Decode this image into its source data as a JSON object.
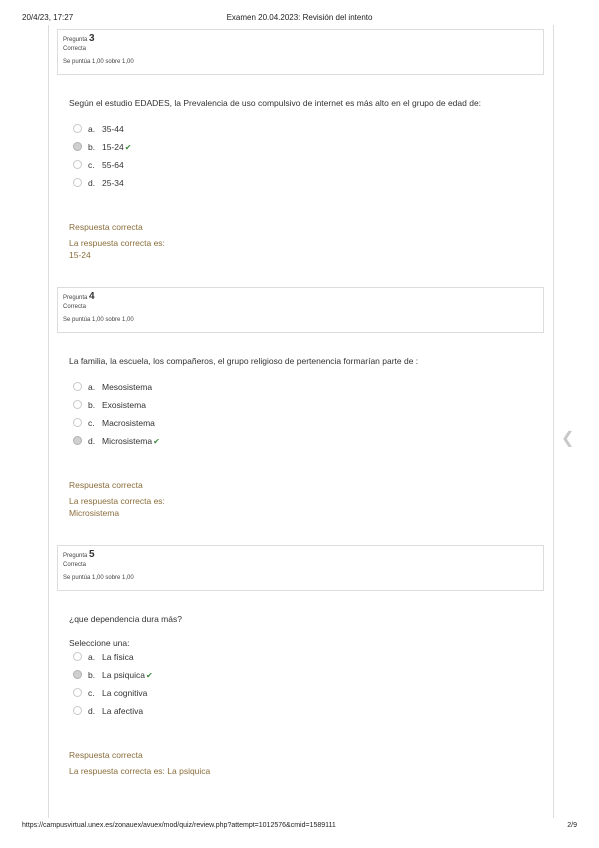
{
  "print_header": {
    "date": "20/4/23, 17:27",
    "title": "Examen 20.04.2023: Revisión del intento"
  },
  "print_footer": {
    "url": "https://campusvirtual.unex.es/zonauex/avuex/mod/quiz/review.php?attempt=1012576&cmid=1589111",
    "pages": "2/9"
  },
  "questions": [
    {
      "label": "Pregunta",
      "number": "3",
      "state": "Correcta",
      "grade": "Se puntúa 1,00 sobre 1,00",
      "text": "Según el estudio EDADES,  la Prevalencia de uso compulsivo de internet es más alto en el grupo de edad de:",
      "options": [
        {
          "letter": "a.",
          "text": "35-44"
        },
        {
          "letter": "b.",
          "text": "15-24"
        },
        {
          "letter": "c.",
          "text": "55-64"
        },
        {
          "letter": "d.",
          "text": "25-34"
        }
      ],
      "feedback": "Respuesta correcta",
      "answer_label": "La respuesta correcta es:",
      "answer": "15-24"
    },
    {
      "label": "Pregunta",
      "number": "4",
      "state": "Correcta",
      "grade": "Se puntúa 1,00 sobre 1,00",
      "text": "La familia, la escuela, los compañeros, el grupo religioso de pertenencia formarían parte de :",
      "options": [
        {
          "letter": "a.",
          "text": "Mesosistema"
        },
        {
          "letter": "b.",
          "text": "Exosistema"
        },
        {
          "letter": "c.",
          "text": "Macrosistema"
        },
        {
          "letter": "d.",
          "text": "Microsistema"
        }
      ],
      "feedback": "Respuesta correcta",
      "answer_label": "La respuesta correcta es:",
      "answer": "Microsistema"
    },
    {
      "label": "Pregunta",
      "number": "5",
      "state": "Correcta",
      "grade": "Se puntúa 1,00 sobre 1,00",
      "text": "¿que dependencia dura más?",
      "prompt": "Seleccione una:",
      "options": [
        {
          "letter": "a.",
          "text": "La física"
        },
        {
          "letter": "b.",
          "text": "La psiquica"
        },
        {
          "letter": "c.",
          "text": "La cognitiva"
        },
        {
          "letter": "d.",
          "text": "La afectiva"
        }
      ],
      "feedback": "Respuesta correcta",
      "answer_full": "La respuesta correcta es: La psiquica"
    }
  ],
  "icons": {
    "check": "check-icon",
    "radio": "radio-icon",
    "nav": "chevron-left-icon"
  },
  "colors": {
    "feedback": "#8a6d3b",
    "check": "#3c8c3c"
  }
}
